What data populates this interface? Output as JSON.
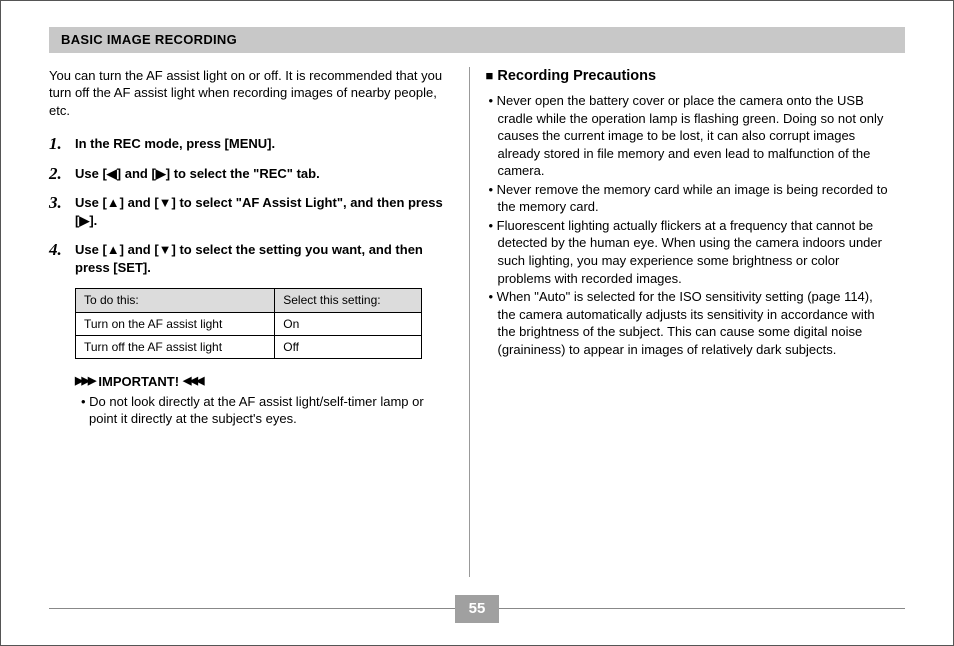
{
  "section_title": "BASIC IMAGE RECORDING",
  "intro": "You can turn the AF assist light on or off. It is recommended that you turn off the AF assist light when recording images of nearby people, etc.",
  "steps": [
    "In the REC mode, press [MENU].",
    "Use [◀] and [▶] to select the \"REC\" tab.",
    "Use [▲] and [▼] to select \"AF Assist Light\", and then press [▶].",
    "Use [▲] and [▼] to select the setting you want, and then press [SET]."
  ],
  "table": {
    "headers": [
      "To do this:",
      "Select this setting:"
    ],
    "rows": [
      [
        "Turn on the AF assist light",
        "On"
      ],
      [
        "Turn off the AF assist light",
        "Off"
      ]
    ]
  },
  "important_label": "IMPORTANT!",
  "important_text": "• Do not look directly at the AF assist light/self-timer lamp or point it directly at the subject's eyes.",
  "right_heading": "Recording Precautions",
  "right_bullets": [
    "Never open the battery cover or place the camera onto the USB cradle while the operation lamp is flashing green. Doing so not only causes the current image to be lost, it can also corrupt images already stored in file memory and even lead to malfunction of the camera.",
    "Never remove the memory card while an image is being recorded to the memory card.",
    "Fluorescent lighting actually flickers at a frequency that cannot be detected by the human eye. When using the camera indoors under such lighting, you may experience some brightness or color problems with recorded images.",
    "When \"Auto\" is selected for the ISO sensitivity setting (page 114), the camera automatically adjusts its sensitivity in accordance with the brightness of the subject. This can cause some digital noise (graininess) to appear in images of relatively dark subjects."
  ],
  "page_number": "55"
}
